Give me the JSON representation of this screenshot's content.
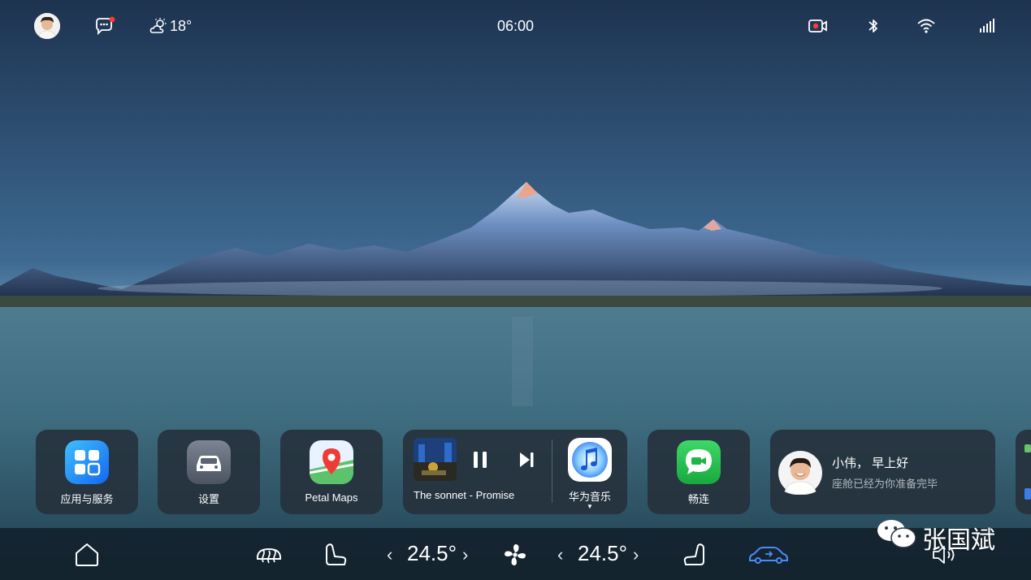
{
  "status_bar": {
    "weather_temp": "18°",
    "time": "06:00"
  },
  "cards": {
    "apps_services": "应用与服务",
    "settings": "设置",
    "petal_maps": "Petal Maps",
    "music": {
      "track": "The sonnet - Promise",
      "app_name": "华为音乐"
    },
    "changlian": "畅连",
    "greeting": {
      "title": "小伟， 早上好",
      "subtitle": "座舱已经为你准备完毕"
    }
  },
  "dock": {
    "left_temp": "24.5°",
    "right_temp": "24.5°"
  },
  "watermark": "张国斌",
  "colors": {
    "accent_blue": "#4a8cf7",
    "notification_red": "#ff3b30",
    "card_bg": "#24303a",
    "music_app_red": "#e53935",
    "changlian_green": "#21b84a"
  }
}
